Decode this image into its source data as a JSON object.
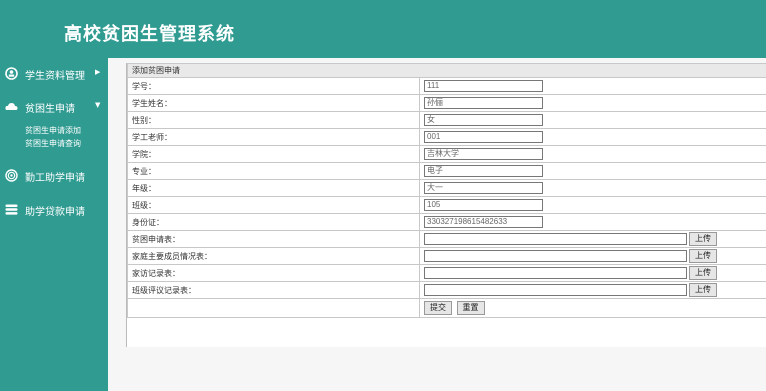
{
  "header": {
    "title": "高校贫困生管理系统"
  },
  "sidebar": {
    "items": [
      {
        "label": "学生资料管理",
        "icon": "student-profile-icon",
        "arrow": "▶"
      },
      {
        "label": "贫困生申请",
        "icon": "cloud-icon",
        "arrow": "▼",
        "subitems": [
          {
            "label": "贫困生申请添加"
          },
          {
            "label": "贫困生申请查询"
          }
        ]
      },
      {
        "label": "勤工助学申请",
        "icon": "target-icon"
      },
      {
        "label": "助学贷款申请",
        "icon": "stack-icon"
      }
    ]
  },
  "form": {
    "title": "添加贫困申请",
    "fields": [
      {
        "label": "学号：",
        "value": "111"
      },
      {
        "label": "学生姓名：",
        "value": "孙俪"
      },
      {
        "label": "性别：",
        "value": "女"
      },
      {
        "label": "学工老师：",
        "value": "001"
      },
      {
        "label": "学院：",
        "value": "吉林大学"
      },
      {
        "label": "专业：",
        "value": "电子"
      },
      {
        "label": "年级：",
        "value": "大一"
      },
      {
        "label": "班级：",
        "value": "105"
      },
      {
        "label": "身份证：",
        "value": "330327198615482633"
      }
    ],
    "uploads": [
      {
        "label": "贫困申请表：",
        "button": "上传"
      },
      {
        "label": "家庭主要成员情况表：",
        "button": "上传"
      },
      {
        "label": "家访记录表：",
        "button": "上传"
      },
      {
        "label": "班级评议记录表：",
        "button": "上传"
      }
    ],
    "submit_label": "提交",
    "reset_label": "重置"
  }
}
